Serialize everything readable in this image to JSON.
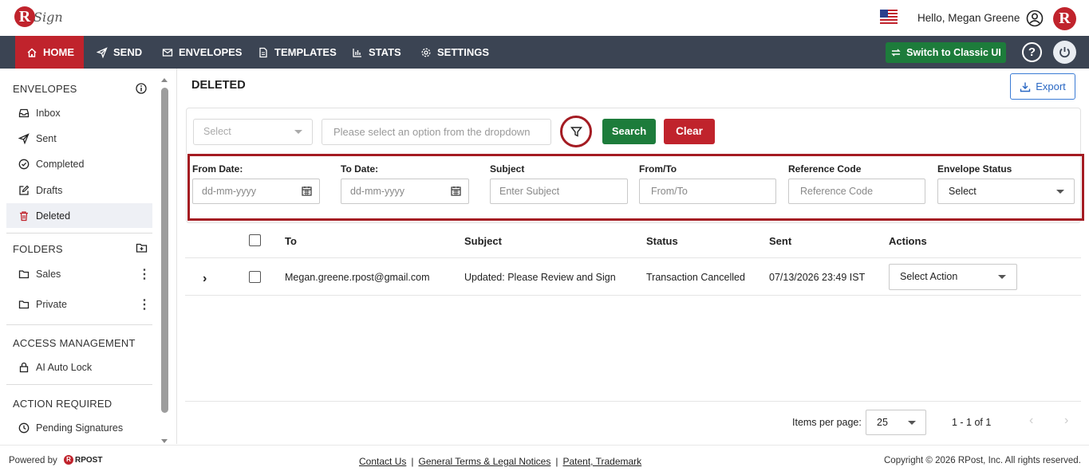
{
  "header": {
    "brand_mark": "R",
    "brand_text": "Sign",
    "greeting": "Hello, Megan Greene",
    "avatar_mark": "R"
  },
  "nav": {
    "items": [
      {
        "label": "HOME",
        "icon": "home-icon"
      },
      {
        "label": "SEND",
        "icon": "send-icon"
      },
      {
        "label": "ENVELOPES",
        "icon": "envelope-icon"
      },
      {
        "label": "TEMPLATES",
        "icon": "template-icon"
      },
      {
        "label": "STATS",
        "icon": "stats-icon"
      },
      {
        "label": "SETTINGS",
        "icon": "gear-icon"
      }
    ],
    "switch_label": "Switch to Classic UI",
    "help_label": "?"
  },
  "sidebar": {
    "envelopes_title": "ENVELOPES",
    "envelopes": [
      {
        "label": "Inbox",
        "icon": "inbox-icon"
      },
      {
        "label": "Sent",
        "icon": "send-icon"
      },
      {
        "label": "Completed",
        "icon": "check-circle-icon"
      },
      {
        "label": "Drafts",
        "icon": "edit-icon"
      },
      {
        "label": "Deleted",
        "icon": "trash-icon"
      }
    ],
    "folders_title": "FOLDERS",
    "folders": [
      {
        "label": "Sales",
        "icon": "folder-icon"
      },
      {
        "label": "Private",
        "icon": "folder-icon"
      }
    ],
    "access_title": "ACCESS MANAGEMENT",
    "access_items": [
      {
        "label": "AI Auto Lock",
        "icon": "lock-icon"
      }
    ],
    "action_title": "ACTION REQUIRED",
    "action_items": [
      {
        "label": "Pending Signatures",
        "icon": "clock-icon"
      }
    ]
  },
  "main": {
    "title": "DELETED",
    "export_label": "Export",
    "search": {
      "select_placeholder": "Select",
      "input_placeholder": "Please select an option from the dropdown",
      "search_label": "Search",
      "clear_label": "Clear"
    },
    "filters": {
      "from_date_label": "From Date:",
      "from_date_placeholder": "dd-mm-yyyy",
      "to_date_label": "To Date:",
      "to_date_placeholder": "dd-mm-yyyy",
      "subject_label": "Subject",
      "subject_placeholder": "Enter Subject",
      "fromto_label": "From/To",
      "fromto_placeholder": "From/To",
      "refcode_label": "Reference Code",
      "refcode_placeholder": "Reference Code",
      "status_label": "Envelope Status",
      "status_value": "Select"
    },
    "table": {
      "columns": [
        "To",
        "Subject",
        "Status",
        "Sent",
        "Actions"
      ],
      "rows": [
        {
          "to": "Megan.greene.rpost@gmail.com",
          "subject": "Updated: Please Review and Sign",
          "status": "Transaction Cancelled",
          "sent": "07/13/2026 23:49 IST",
          "action": "Select Action"
        }
      ]
    },
    "pager": {
      "items_per_page_label": "Items per page:",
      "items_per_page": "25",
      "range": "1 - 1 of 1"
    }
  },
  "footer": {
    "powered_by": "Powered by",
    "rpost_text": "RPOST",
    "links": [
      "Contact Us",
      "General Terms & Legal Notices",
      "Patent, Trademark"
    ],
    "copyright": "Copyright © 2026 RPost, Inc. All rights reserved."
  },
  "colors": {
    "brand_red": "#c0232c",
    "nav_bg": "#3b4453",
    "green": "#1d7c3b",
    "highlight_red": "#a41b22",
    "link_blue": "#2a68c4"
  }
}
